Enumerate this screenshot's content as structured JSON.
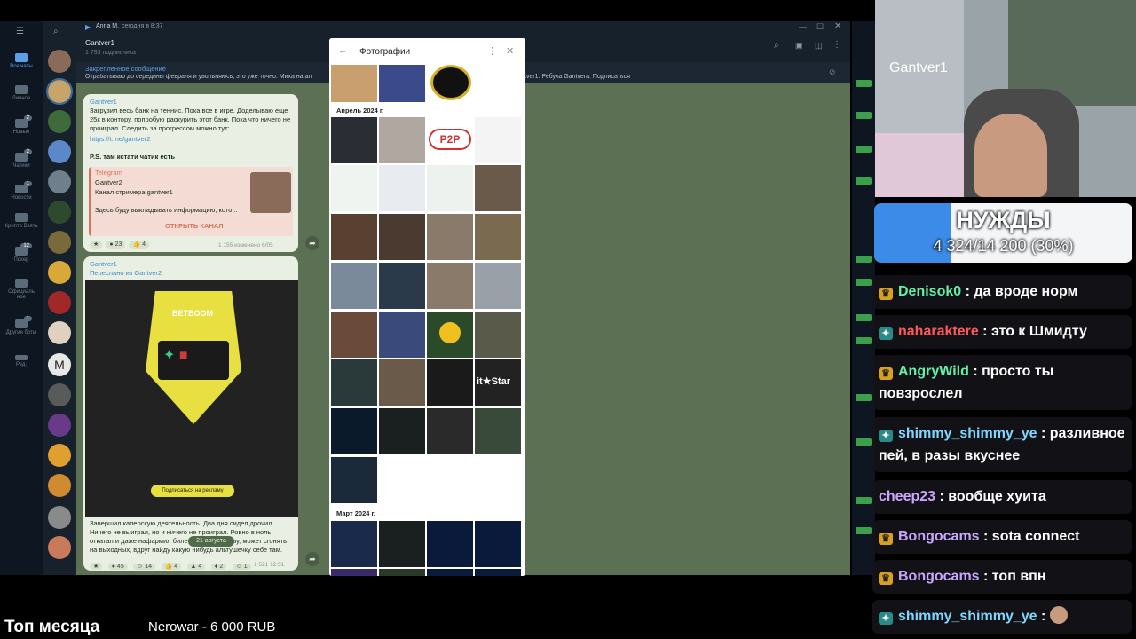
{
  "telegram": {
    "titlebar": {
      "sender": "Anna M.",
      "time_text": "сегодня в 8:37"
    },
    "folders": [
      {
        "label": "Все чаты",
        "badge": ""
      },
      {
        "label": "Личное",
        "badge": ""
      },
      {
        "label": "Новые",
        "badge": "2"
      },
      {
        "label": "Чатики",
        "badge": "2"
      },
      {
        "label": "Новости",
        "badge": "1"
      },
      {
        "label": "Крипто Взять",
        "badge": ""
      },
      {
        "label": "Покер",
        "badge": "12"
      },
      {
        "label": "Официаль ное",
        "badge": ""
      },
      {
        "label": "Другие боты",
        "badge": "1"
      },
      {
        "label": "Ред.",
        "badge": ""
      }
    ],
    "chat_header": {
      "title": "Gantver1",
      "subtitle": "1 793 подписчика"
    },
    "pinned": {
      "label": "Закреплённое сообщение",
      "text": "Отрабатываю до середины февраля и увольняюсь, это уже точно. Миха на ал",
      "text_right": "tver1. Ребуха Gantvera. Подписаться"
    },
    "message1": {
      "author": "Gantver1",
      "text": "Загрузил весь банк на теннис. Пока все в игре. Доделываю еще 25к в контору, попробую раскурить этот банк. Пока что ничего не проиграл. Следить за прогрессом можно тут:",
      "link": "https://t.me/gantver2",
      "ps": "P.S. там кстати чатик есть",
      "preview_source": "Telegram",
      "preview_title": "Gantver2",
      "preview_desc": "Канал стримера gantver1",
      "preview_text": "Здесь буду выкладывать информацию, кото...",
      "open_label": "ОТКРЫТЬ КАНАЛ",
      "reactions": [
        "23",
        "4"
      ],
      "meta": "1 155 изменено 6/05"
    },
    "message2": {
      "author": "Gantver1",
      "forwarded": "Переслано из",
      "forward_from": "Gantver2",
      "phone_brand": "BETBOOM",
      "phone_button": "Подписаться на рекламу",
      "text": "Завершил каперскую деятельность. Два дня сидел дрочил. Ничего не выиграл, но и ничего не проиграл. Ровно в ноль откатал и даже нафармил билет на Бетбум базу, может сгонять на выходных, вдруг найду какую нибудь альтушечку себе там.",
      "reactions": [
        "45",
        "14",
        "4",
        "4",
        "2",
        "1"
      ],
      "meta": "1 521 12:51"
    },
    "date_pill": "21 августа"
  },
  "photos_popup": {
    "title": "Фотографии",
    "section1": "Апрель 2024 г.",
    "section2": "Март 2024 г.",
    "p2p_label": "P2P",
    "bitstarz_label": "it★Star"
  },
  "stream": {
    "camera_name": "Gantver1",
    "goal": {
      "title": "НУЖДЫ",
      "progress_text": "4 324/14 200 (30%)",
      "progress": 0.3
    },
    "chat": [
      {
        "user": "Denisok0",
        "msg": ": да вроде норм",
        "color": "#65f0a8",
        "badge": "crown"
      },
      {
        "user": "naharaktere",
        "msg": ": это к Шмидту",
        "color": "#ff5a5a",
        "badge": "gift"
      },
      {
        "user": "AngryWild",
        "msg": ": просто ты повзрослел",
        "color": "#65f0a8",
        "badge": "crown"
      },
      {
        "user": "shimmy_shimmy_ye",
        "msg": ": разливное пей, в разы вкуснее",
        "color": "#7fd6ff",
        "badge": "gift"
      },
      {
        "user": "cheep23",
        "msg": ": вообще хуита",
        "color": "#c9a7ff",
        "badge": ""
      },
      {
        "user": "Bongocams",
        "msg": ": sota connect",
        "color": "#c9a7ff",
        "badge": "crown"
      },
      {
        "user": "Bongocams",
        "msg": ": топ впн",
        "color": "#c9a7ff",
        "badge": "crown"
      },
      {
        "user": "shimmy_shimmy_ye",
        "msg": ":",
        "color": "#7fd6ff",
        "badge": "gift"
      }
    ],
    "top_month_label": "Топ месяца",
    "top_donation": "Nerowar - 6 000 RUB"
  }
}
